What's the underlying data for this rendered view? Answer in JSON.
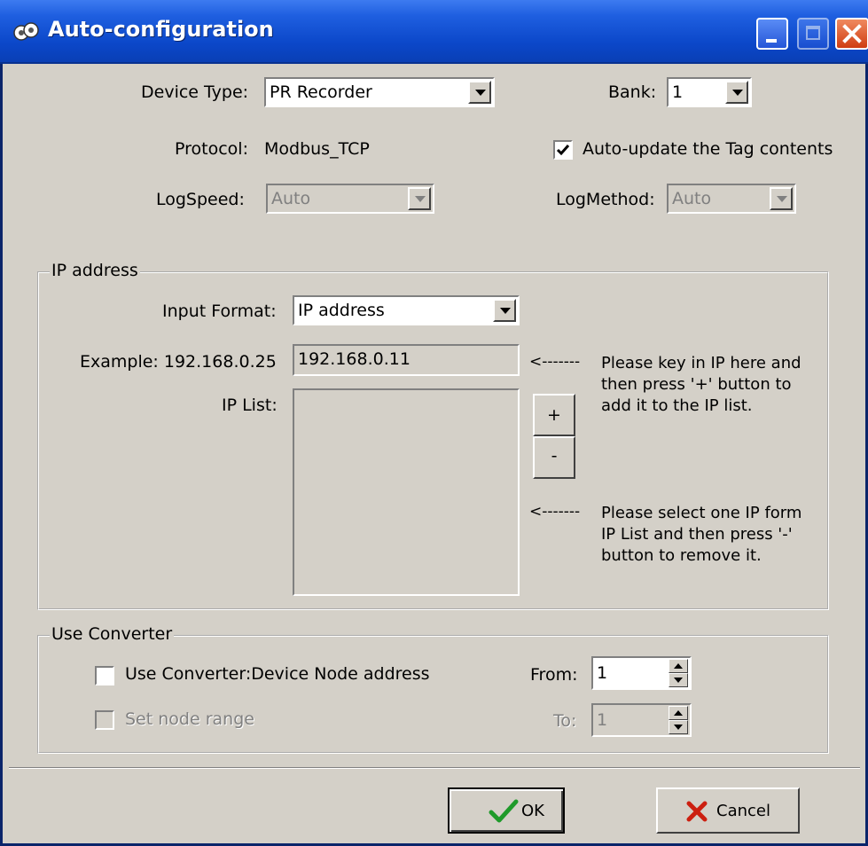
{
  "window": {
    "title": "Auto-configuration"
  },
  "device": {
    "type_label": "Device Type:",
    "type_value": "PR Recorder",
    "bank_label": "Bank:",
    "bank_value": "1",
    "protocol_label": "Protocol:",
    "protocol_value": "Modbus_TCP",
    "autoupdate_label": "Auto-update the Tag contents",
    "autoupdate_checked": true,
    "logspeed_label": "LogSpeed:",
    "logspeed_value": "Auto",
    "logmethod_label": "LogMethod:",
    "logmethod_value": "Auto"
  },
  "ip": {
    "group_title": "IP address",
    "format_label": "Input Format:",
    "format_value": "IP address",
    "example_label": "Example: 192.168.0.25",
    "ip_value": "192.168.0.11",
    "arrow1": "<-------",
    "hint1": "Please key in IP here and\nthen press '+' button to\nadd it to the IP list.",
    "list_label": "IP List:",
    "add_label": "+",
    "remove_label": "-",
    "arrow2": "<-------",
    "hint2": "Please select one IP form\nIP List and then press '-'\nbutton to remove it."
  },
  "converter": {
    "group_title": "Use Converter",
    "use_label": "Use Converter:Device Node address",
    "range_label": "Set node range",
    "from_label": "From:",
    "from_value": "1",
    "to_label": "To:",
    "to_value": "1"
  },
  "buttons": {
    "ok_label": "OK",
    "cancel_label": "Cancel"
  },
  "colors": {
    "titlebar": "#0a3fb5",
    "face": "#d4d0c8",
    "ok_check": "#1f9a2a",
    "cancel_x": "#cc1f10",
    "close": "#cf3d12"
  }
}
